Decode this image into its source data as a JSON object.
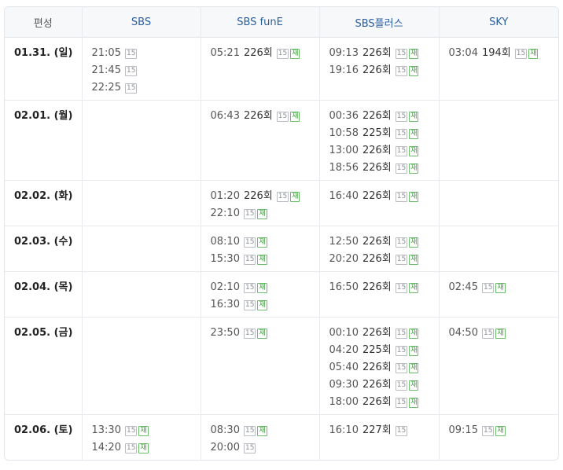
{
  "header": {
    "label": "편성",
    "channels": [
      "SBS",
      "SBS funE",
      "SBS플러스",
      "SKY"
    ]
  },
  "rows": [
    {
      "date": "01.31. (일)",
      "cells": [
        [
          {
            "time": "21:05",
            "ep": "",
            "rating": "15",
            "re": ""
          },
          {
            "time": "21:45",
            "ep": "",
            "rating": "15",
            "re": ""
          },
          {
            "time": "22:25",
            "ep": "",
            "rating": "15",
            "re": ""
          }
        ],
        [
          {
            "time": "05:21",
            "ep": "226회",
            "rating": "15",
            "re": "재"
          }
        ],
        [
          {
            "time": "09:13",
            "ep": "226회",
            "rating": "15",
            "re": "재"
          },
          {
            "time": "19:16",
            "ep": "226회",
            "rating": "15",
            "re": "재"
          }
        ],
        [
          {
            "time": "03:04",
            "ep": "194회",
            "rating": "15",
            "re": "재"
          }
        ]
      ]
    },
    {
      "date": "02.01. (월)",
      "cells": [
        [],
        [
          {
            "time": "06:43",
            "ep": "226회",
            "rating": "15",
            "re": "재"
          }
        ],
        [
          {
            "time": "00:36",
            "ep": "226회",
            "rating": "15",
            "re": "재"
          },
          {
            "time": "10:58",
            "ep": "225회",
            "rating": "15",
            "re": "재"
          },
          {
            "time": "13:00",
            "ep": "226회",
            "rating": "15",
            "re": "재"
          },
          {
            "time": "18:56",
            "ep": "226회",
            "rating": "15",
            "re": "재"
          }
        ],
        []
      ]
    },
    {
      "date": "02.02. (화)",
      "cells": [
        [],
        [
          {
            "time": "01:20",
            "ep": "226회",
            "rating": "15",
            "re": "재"
          },
          {
            "time": "22:10",
            "ep": "",
            "rating": "15",
            "re": "재"
          }
        ],
        [
          {
            "time": "16:40",
            "ep": "226회",
            "rating": "15",
            "re": "재"
          }
        ],
        []
      ]
    },
    {
      "date": "02.03. (수)",
      "cells": [
        [],
        [
          {
            "time": "08:10",
            "ep": "",
            "rating": "15",
            "re": "재"
          },
          {
            "time": "15:30",
            "ep": "",
            "rating": "15",
            "re": "재"
          }
        ],
        [
          {
            "time": "12:50",
            "ep": "226회",
            "rating": "15",
            "re": "재"
          },
          {
            "time": "20:20",
            "ep": "226회",
            "rating": "15",
            "re": "재"
          }
        ],
        []
      ]
    },
    {
      "date": "02.04. (목)",
      "cells": [
        [],
        [
          {
            "time": "02:10",
            "ep": "",
            "rating": "15",
            "re": "재"
          },
          {
            "time": "16:30",
            "ep": "",
            "rating": "15",
            "re": "재"
          }
        ],
        [
          {
            "time": "16:50",
            "ep": "226회",
            "rating": "15",
            "re": "재"
          }
        ],
        [
          {
            "time": "02:45",
            "ep": "",
            "rating": "15",
            "re": "재"
          }
        ]
      ]
    },
    {
      "date": "02.05. (금)",
      "cells": [
        [],
        [
          {
            "time": "23:50",
            "ep": "",
            "rating": "15",
            "re": "재"
          }
        ],
        [
          {
            "time": "00:10",
            "ep": "226회",
            "rating": "15",
            "re": "재"
          },
          {
            "time": "04:20",
            "ep": "225회",
            "rating": "15",
            "re": "재"
          },
          {
            "time": "05:40",
            "ep": "226회",
            "rating": "15",
            "re": "재"
          },
          {
            "time": "09:30",
            "ep": "226회",
            "rating": "15",
            "re": "재"
          },
          {
            "time": "18:00",
            "ep": "226회",
            "rating": "15",
            "re": "재"
          }
        ],
        [
          {
            "time": "04:50",
            "ep": "",
            "rating": "15",
            "re": "재"
          }
        ]
      ]
    },
    {
      "date": "02.06. (토)",
      "cells": [
        [
          {
            "time": "13:30",
            "ep": "",
            "rating": "15",
            "re": "재"
          },
          {
            "time": "14:20",
            "ep": "",
            "rating": "15",
            "re": "재"
          }
        ],
        [
          {
            "time": "08:30",
            "ep": "",
            "rating": "15",
            "re": "재"
          },
          {
            "time": "20:00",
            "ep": "",
            "rating": "15",
            "re": ""
          }
        ],
        [
          {
            "time": "16:10",
            "ep": "227회",
            "rating": "15",
            "re": ""
          }
        ],
        [
          {
            "time": "09:15",
            "ep": "",
            "rating": "15",
            "re": "재"
          }
        ]
      ]
    }
  ]
}
